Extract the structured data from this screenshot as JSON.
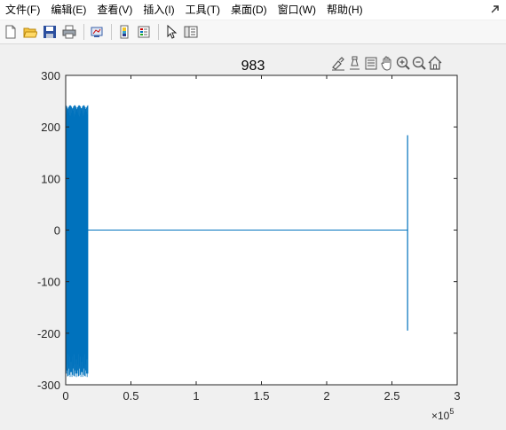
{
  "menu": {
    "items": [
      "文件(F)",
      "编辑(E)",
      "查看(V)",
      "插入(I)",
      "工具(T)",
      "桌面(D)",
      "窗口(W)",
      "帮助(H)"
    ]
  },
  "toolbar": {
    "icons": [
      "new-figure-icon",
      "open-file-icon",
      "save-icon",
      "print-icon",
      "link-plot-icon",
      "insert-colorbar-icon",
      "insert-legend-icon",
      "edit-plot-pointer-icon",
      "property-inspector-icon"
    ]
  },
  "axes_toolbar": {
    "icons": [
      "brush-icon",
      "data-tip-icon",
      "rotate-icon",
      "pan-icon",
      "zoom-in-icon",
      "zoom-out-icon",
      "restore-view-icon"
    ]
  },
  "colors": {
    "line": "#0072bd",
    "axes_bg": "#ffffff",
    "figure_bg": "#f0f0f0"
  },
  "chart_data": {
    "type": "line",
    "title": "983",
    "xlim": [
      0,
      300000
    ],
    "ylim": [
      -300,
      300
    ],
    "x_exponent_label": "×10",
    "x_exponent": "5",
    "xticks": [
      0,
      50000,
      100000,
      150000,
      200000,
      250000,
      300000
    ],
    "xtick_labels": [
      "0",
      "0.5",
      "1",
      "1.5",
      "2",
      "2.5",
      "3"
    ],
    "yticks": [
      300,
      200,
      100,
      0,
      -100,
      -200,
      -300
    ],
    "ytick_labels": [
      "300",
      "200",
      "100",
      "0",
      "-100",
      "-200",
      "-300"
    ],
    "grid": false,
    "series": [
      {
        "segments": [
          {
            "kind": "dense-burst",
            "x_start": 0,
            "x_end": 17000,
            "y_min": -285,
            "y_max": 242,
            "core_min": -200,
            "core_max": 200
          },
          {
            "kind": "flat",
            "x_start": 17000,
            "x_end": 262000,
            "y": 0
          },
          {
            "kind": "spike",
            "x": 262000,
            "y_max": 184,
            "y_min": -195
          }
        ]
      }
    ]
  }
}
